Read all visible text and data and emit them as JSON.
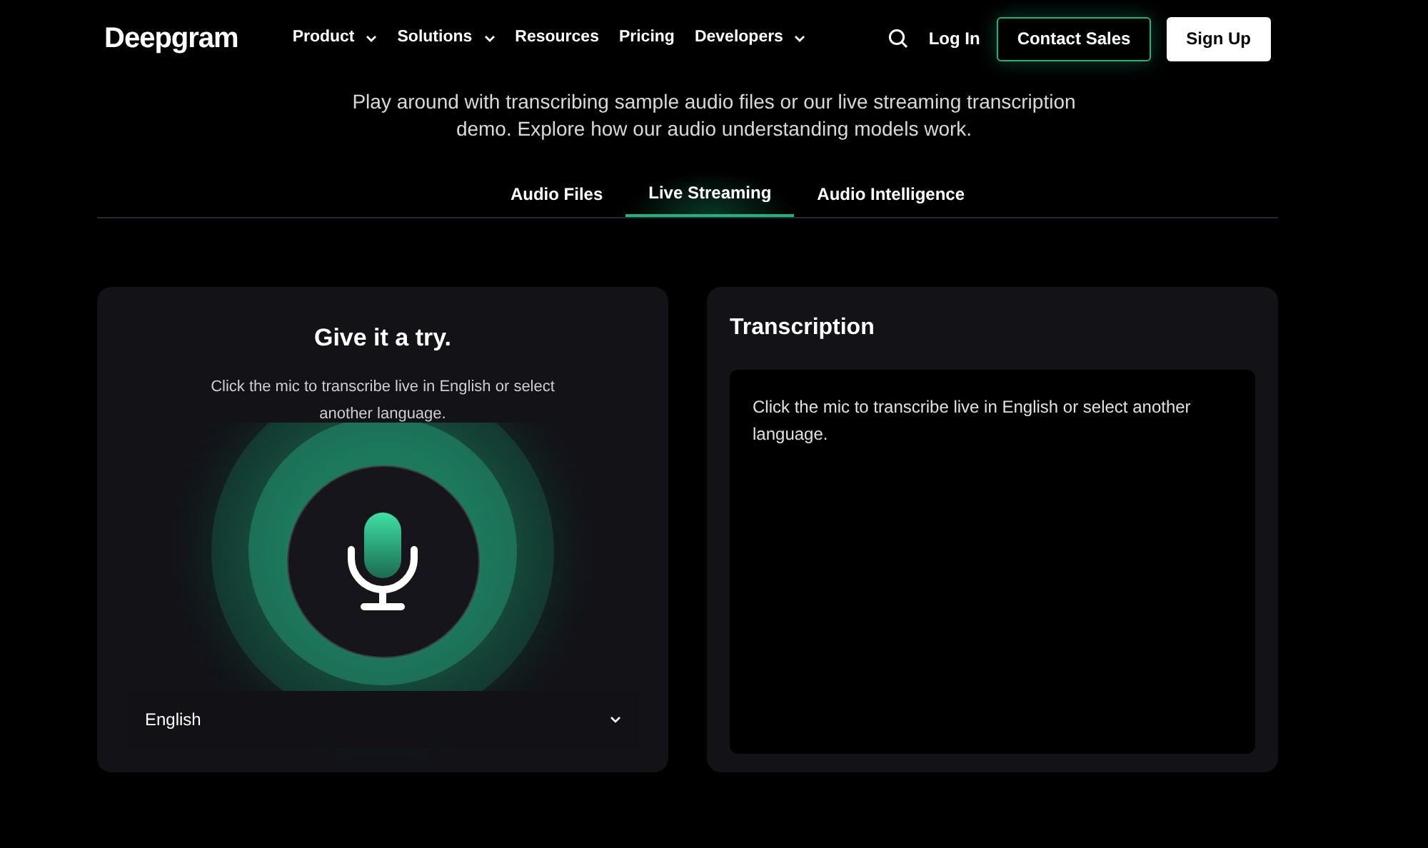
{
  "header": {
    "logo": "Deepgram",
    "nav": [
      {
        "label": "Product",
        "kind": "dropdown"
      },
      {
        "label": "Solutions",
        "kind": "dropdown"
      },
      {
        "label": "Resources",
        "kind": "link"
      },
      {
        "label": "Pricing",
        "kind": "link"
      },
      {
        "label": "Developers",
        "kind": "dropdown"
      }
    ],
    "login": "Log In",
    "contact": "Contact Sales",
    "signup": "Sign Up"
  },
  "intro": "Play around with transcribing sample audio files or our live streaming transcription demo. Explore how our audio understanding models work.",
  "tabs": [
    {
      "label": "Audio Files",
      "selected": false
    },
    {
      "label": "Live Streaming",
      "selected": true
    },
    {
      "label": "Audio Intelligence",
      "selected": false
    }
  ],
  "try_panel": {
    "title": "Give it a try.",
    "hint": "Click the mic to transcribe live in English or select another language.",
    "language": "English"
  },
  "transcription": {
    "title": "Transcription",
    "text": "Click the mic to transcribe live in English or select another language."
  }
}
